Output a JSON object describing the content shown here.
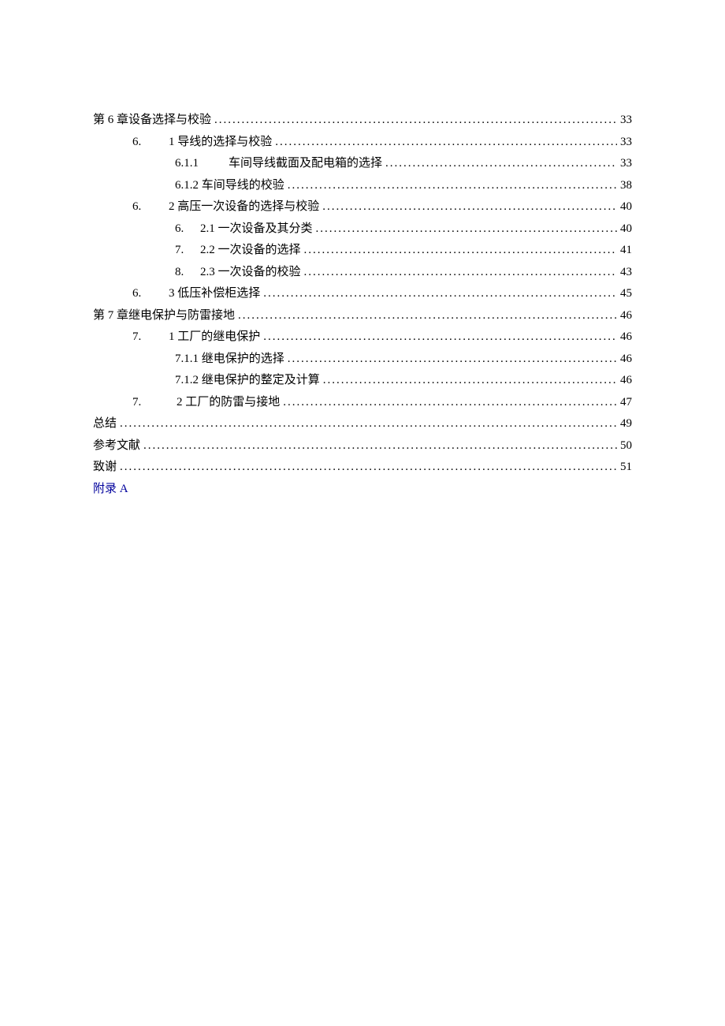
{
  "toc": {
    "entries": [
      {
        "indent": 0,
        "prefix": "",
        "title": "第 6 章设备选择与校验",
        "page": "33"
      },
      {
        "indent": 1,
        "prefix": "6.",
        "title": "1 导线的选择与校验",
        "page": "33"
      },
      {
        "indent": 2,
        "prefix": "6.1.1",
        "title": "车间导线截面及配电箱的选择",
        "page": "33"
      },
      {
        "indent": 2,
        "prefix": "",
        "title": "6.1.2 车间导线的校验",
        "page": "38"
      },
      {
        "indent": 1,
        "prefix": "6.",
        "title": "2 高压一次设备的选择与校验",
        "page": "40"
      },
      {
        "indent": 2,
        "prefix": "6.",
        "title": "2.1 一次设备及其分类",
        "page": "40"
      },
      {
        "indent": 2,
        "prefix": "7.",
        "title": "2.2 一次设备的选择",
        "page": "41"
      },
      {
        "indent": 2,
        "prefix": "8.",
        "title": "2.3 一次设备的校验",
        "page": "43"
      },
      {
        "indent": 1,
        "prefix": "6.",
        "title": "3 低压补偿柜选择",
        "page": "45"
      },
      {
        "indent": 0,
        "prefix": "",
        "title": "第 7 章继电保护与防雷接地",
        "page": "46"
      },
      {
        "indent": 1,
        "prefix": "7.",
        "title": "1 工厂的继电保护",
        "page": "46"
      },
      {
        "indent": 2,
        "prefix": "",
        "title": "7.1.1 继电保护的选择",
        "page": "46"
      },
      {
        "indent": 2,
        "prefix": "",
        "title": "7.1.2 继电保护的整定及计算",
        "page": "46"
      },
      {
        "indent": 1,
        "prefix": "7.",
        "title": "2 工厂的防雷与接地",
        "page": "47"
      },
      {
        "indent": 0,
        "prefix": "",
        "title": "总结",
        "page": "49"
      },
      {
        "indent": 0,
        "prefix": "",
        "title": "参考文献",
        "page": "50"
      },
      {
        "indent": 0,
        "prefix": "",
        "title": "致谢",
        "page": "51"
      }
    ],
    "appendix": "附录 A"
  }
}
